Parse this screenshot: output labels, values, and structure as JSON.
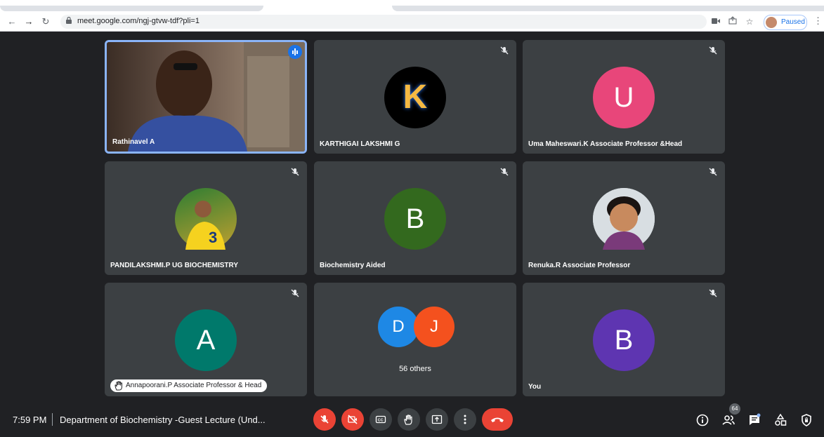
{
  "browser": {
    "url": "meet.google.com/ngj-gtvw-tdf?pli=1",
    "profile_status": "Paused"
  },
  "tiles": [
    {
      "name": "Rathinavel A"
    },
    {
      "name": "KARTHIGAI LAKSHMI G",
      "initial": "K"
    },
    {
      "name": "Uma Maheswari.K Associate Professor &Head",
      "initial": "U",
      "color": "#e8467a"
    },
    {
      "name": "PANDILAKSHMI.P UG BIOCHEMISTRY"
    },
    {
      "name": "Biochemistry Aided",
      "initial": "B",
      "color": "#33691e"
    },
    {
      "name": "Renuka.R Associate Professor"
    },
    {
      "name": "Annapoorani.P Associate Professor & Head",
      "initial": "A",
      "color": "#00796b"
    },
    {
      "name": "56 others",
      "initials": [
        "D",
        "J"
      ],
      "colors": [
        "#1e88e5",
        "#f4511e"
      ]
    },
    {
      "name": "You",
      "initial": "B",
      "color": "#5e35b1"
    }
  ],
  "bottom": {
    "time": "7:59 PM",
    "separator": "|",
    "meeting_title": "Department of Biochemistry -Guest Lecture (Und...",
    "participant_count": "64"
  },
  "colors": {
    "accent": "#1a73e8",
    "danger": "#ea4335",
    "tile_bg": "#3c4043",
    "page_bg": "#202124"
  }
}
